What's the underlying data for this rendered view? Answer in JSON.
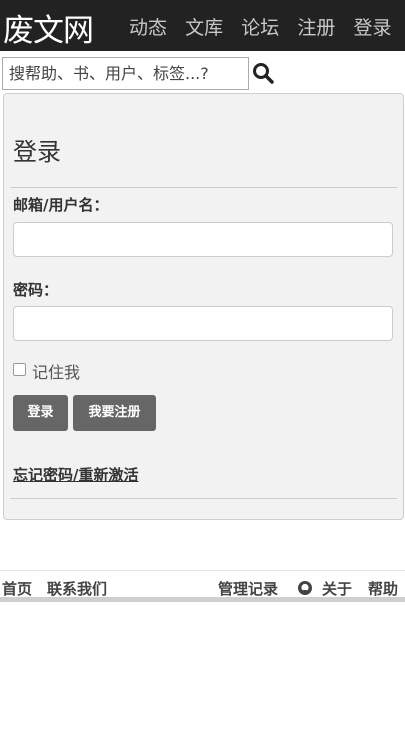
{
  "nav": {
    "brand": "废文网",
    "links": [
      "动态",
      "文库",
      "论坛",
      "注册",
      "登录"
    ]
  },
  "search": {
    "placeholder": "搜帮助、书、用户、标签...?",
    "icon": "search-icon"
  },
  "login": {
    "title": "登录",
    "email_label": "邮箱/用户名：",
    "email_value": "",
    "password_label": "密码：",
    "password_value": "",
    "remember_label": "记住我",
    "remember_checked": false,
    "login_button": "登录",
    "register_button": "我要注册",
    "forgot_link": "忘记密码/重新激活"
  },
  "footer": {
    "home": "首页",
    "contact": "联系我们",
    "admin_log": "管理记录",
    "github_icon": "github-icon",
    "about": "关于",
    "help": "帮助"
  }
}
